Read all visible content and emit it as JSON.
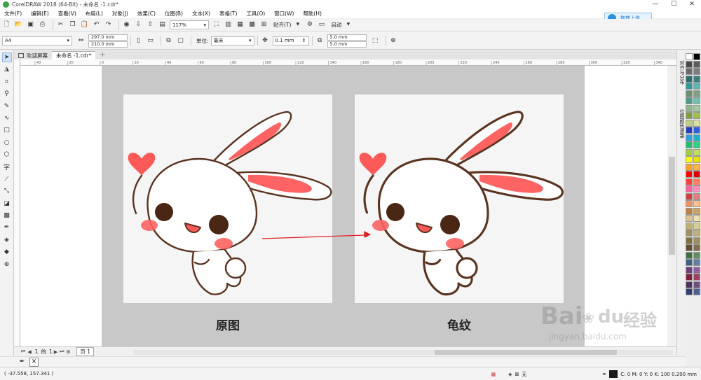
{
  "title_bar": {
    "title": "CorelDRAW 2018 (64-Bit) - 未命名 -1.cdr*",
    "minimize": "—",
    "restore": "☐",
    "close": "✕"
  },
  "menu": [
    "文件(F)",
    "编辑(E)",
    "查看(V)",
    "布局(L)",
    "对象(J)",
    "效果(C)",
    "位图(B)",
    "文本(X)",
    "表格(T)",
    "工具(O)",
    "窗口(W)",
    "帮助(H)"
  ],
  "upload_button": "拖拽上传",
  "toolbar": {
    "zoom_value": "117%",
    "snap_label": "贴齐(T)",
    "launch_label": "启动"
  },
  "property_bar": {
    "page_size": "A4",
    "width": "297.0 mm",
    "height": "210.0 mm",
    "units_label": "单位:",
    "units_value": "毫米",
    "nudge": "0.1 mm",
    "dup_x": "5.0 mm",
    "dup_y": "5.0 mm"
  },
  "doc_tabs": [
    {
      "label": "欢迎屏幕"
    },
    {
      "label": "未命名 -1.cdr*"
    }
  ],
  "ruler_h_labels": [
    "40",
    "20",
    "0",
    "20",
    "40",
    "60",
    "80",
    "100",
    "120",
    "140",
    "160",
    "180",
    "200",
    "220",
    "240",
    "260",
    "280",
    "300",
    "320",
    "340"
  ],
  "canvas": {
    "caption_left": "原图",
    "caption_right": "龟纹",
    "watermark_main": "Bai",
    "watermark_du": "du",
    "watermark_cn": "经验",
    "watermark_url": "jingyan.baidu.com",
    "ear_color": "#ff6363",
    "outline_color": "#5a3420",
    "arrow_color": "#e02020"
  },
  "dockers": [
    "对齐与分布",
    "位图颜色遮罩"
  ],
  "palette": [
    "#ffffff",
    "#000000",
    "#4a4a4a",
    "#5b5b5b",
    "#6c6c6c",
    "#7d7d7d",
    "#2a6e6e",
    "#3a7f7f",
    "#2a9a9a",
    "#5fb3b3",
    "#6e8e6e",
    "#7ea07e",
    "#4f9a8a",
    "#6fc0b0",
    "#8bb88b",
    "#a0c8a0",
    "#7f9f3f",
    "#9fbf4f",
    "#c0d080",
    "#d8e0a0",
    "#1f3fbf",
    "#2f5fdf",
    "#2f9fdf",
    "#1fb0c8",
    "#1fbf6f",
    "#2fd07f",
    "#9fd03f",
    "#c0e05f",
    "#ffff00",
    "#f0e000",
    "#ff9f1f",
    "#ffb03f",
    "#ff0000",
    "#e00000",
    "#ff3f3f",
    "#ff7f5f",
    "#ff5f9f",
    "#ff8fbf",
    "#d03f3f",
    "#e07f7f",
    "#f08f5f",
    "#ffbf8f",
    "#bf7f3f",
    "#d0a060",
    "#e0c090",
    "#f0e0b0",
    "#c0b070",
    "#d8d090",
    "#a08f5f",
    "#c0b080",
    "#7f6f3f",
    "#9f8f5f",
    "#5f4f2f",
    "#7f6f4f",
    "#3f6f3f",
    "#5f8f5f",
    "#3f5f7f",
    "#5f7f9f",
    "#6f3f7f",
    "#8f5f9f",
    "#7f1f3f",
    "#9f3f5f",
    "#4f2f5f",
    "#6f4f7f",
    "#2f3f6f",
    "#4f5f8f"
  ],
  "page_bar": {
    "page_index": "1",
    "of_label": "的",
    "page_total": "1",
    "page_tab": "页 1"
  },
  "fill_bar": {
    "none_label": ""
  },
  "status": {
    "coordinates": "( -37.558, 157.341 )",
    "fill_none": "无",
    "outline_info": "C: 0 M: 0 Y: 0 K: 100  0.200 mm"
  }
}
